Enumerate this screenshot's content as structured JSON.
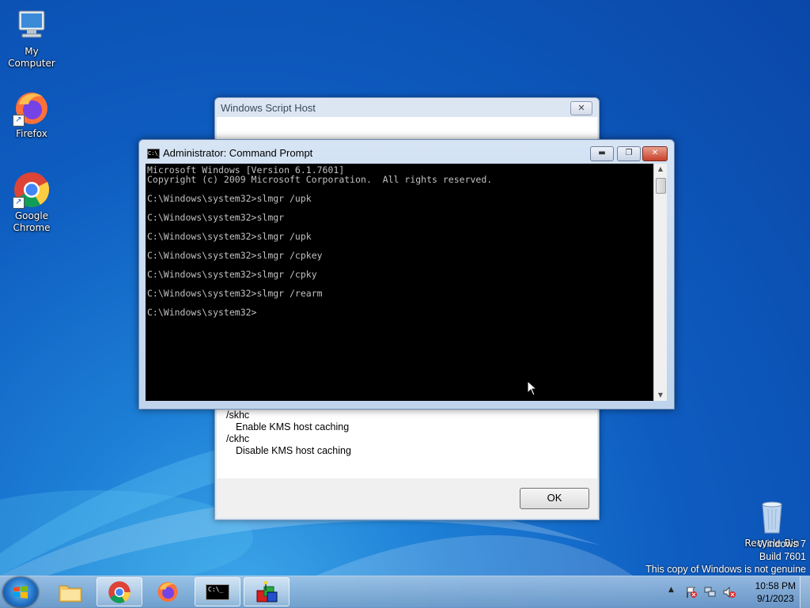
{
  "desktop_icons": {
    "my_computer": "My Computer",
    "firefox": "Firefox",
    "chrome_line1": "Google",
    "chrome_line2": "Chrome",
    "recycle_bin": "Recycle Bin"
  },
  "script_host": {
    "title": "Windows Script Host",
    "close_glyph": "✕",
    "lines": [
      "/skhc",
      "Enable KMS host caching",
      "/ckhc",
      "Disable KMS host caching"
    ],
    "ok_label": "OK"
  },
  "cmd": {
    "title": "Administrator: Command Prompt",
    "icon_text": "C:\\_",
    "minimize_glyph": "▬",
    "maximize_glyph": "❐",
    "close_glyph": "✕",
    "output": "Microsoft Windows [Version 6.1.7601]\nCopyright (c) 2009 Microsoft Corporation.  All rights reserved.\n\nC:\\Windows\\system32>slmgr /upk\n\nC:\\Windows\\system32>slmgr\n\nC:\\Windows\\system32>slmgr /upk\n\nC:\\Windows\\system32>slmgr /cpkey\n\nC:\\Windows\\system32>slmgr /cpky\n\nC:\\Windows\\system32>slmgr /rearm\n\nC:\\Windows\\system32>",
    "scroll_up": "▲",
    "scroll_down": "▼"
  },
  "watermark": {
    "line1": "Windows 7",
    "line2": "Build 7601",
    "line3": "This copy of Windows is not genuine"
  },
  "taskbar": {
    "tray_arrow": "▲",
    "time": "10:58 PM",
    "date": "9/1/2023",
    "cmd_icon_text": "C:\\_"
  }
}
